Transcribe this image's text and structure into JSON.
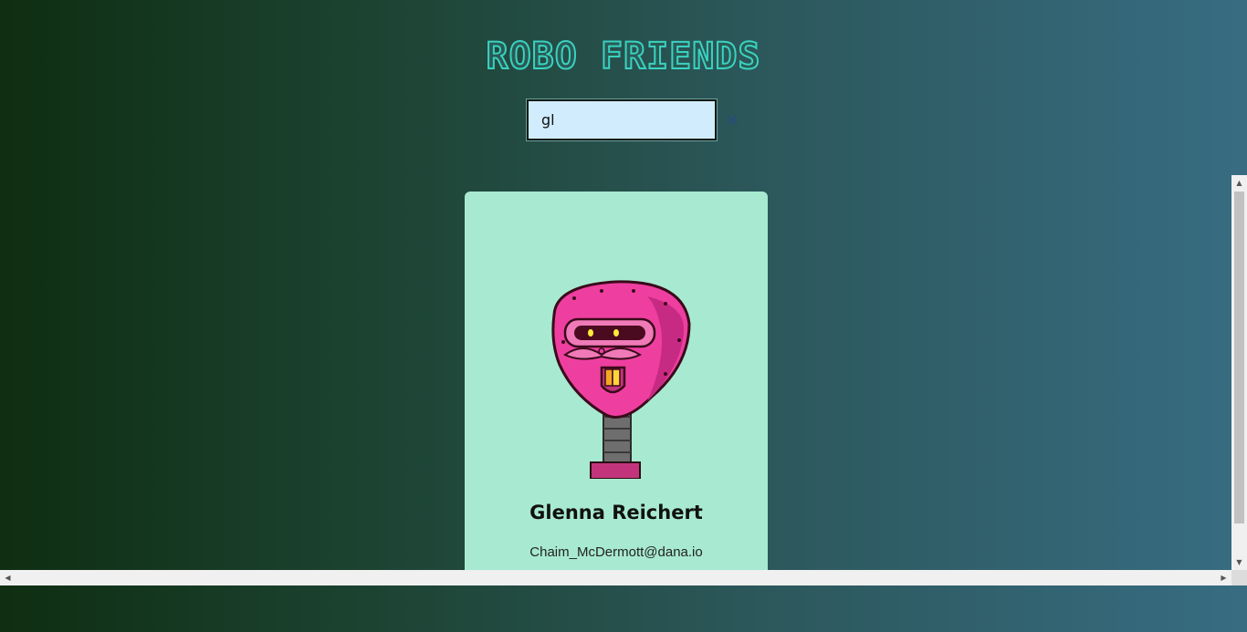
{
  "app": {
    "title": "ROBO FRIENDS"
  },
  "search": {
    "value": "gl",
    "clear_icon": "×"
  },
  "cards": [
    {
      "name": "Glenna Reichert",
      "email": "Chaim_McDermott@dana.io",
      "image": "pink-robot-head"
    }
  ],
  "scrollbars": {
    "up_arrow": "▲",
    "down_arrow": "▼",
    "left_arrow": "◀",
    "right_arrow": "▶"
  },
  "colors": {
    "title_stroke": "#39d2c0",
    "card_bg": "#a8ead1",
    "search_bg": "#d1ecfd",
    "robot_pink": "#ee3fa0"
  }
}
